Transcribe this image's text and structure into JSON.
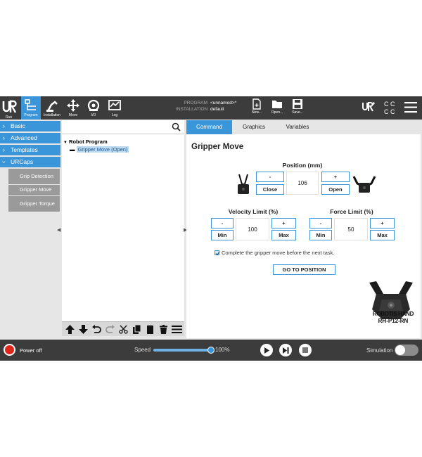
{
  "header": {
    "nav": [
      {
        "label": "Run",
        "icon": "run-icon"
      },
      {
        "label": "Program",
        "icon": "program-icon"
      },
      {
        "label": "Installation",
        "icon": "installation-icon"
      },
      {
        "label": "Move",
        "icon": "move-icon"
      },
      {
        "label": "I/O",
        "icon": "io-icon"
      },
      {
        "label": "Log",
        "icon": "log-icon"
      }
    ],
    "program_label": "PROGRAM",
    "program_value": "<unnamed>*",
    "installation_label": "INSTALLATION",
    "installation_value": "default",
    "file_buttons": [
      {
        "label": "New...",
        "icon": "new-file-icon"
      },
      {
        "label": "Open...",
        "icon": "open-folder-icon"
      },
      {
        "label": "Save...",
        "icon": "save-icon"
      }
    ]
  },
  "sidebar": {
    "categories": [
      "Basic",
      "Advanced",
      "Templates",
      "URCaps"
    ],
    "urcaps_items": [
      "Grip Detection",
      "Gripper Move",
      "Gripper Torque"
    ]
  },
  "tree": {
    "root": "Robot Program",
    "child": "Gripper Move (Open)"
  },
  "tabs": [
    "Command",
    "Graphics",
    "Variables"
  ],
  "panel": {
    "title": "Gripper Move",
    "position": {
      "title": "Position (mm)",
      "minus": "-",
      "plus": "+",
      "value": "106",
      "close": "Close",
      "open": "Open"
    },
    "velocity": {
      "title": "Velocity Limit (%)",
      "minus": "-",
      "plus": "+",
      "value": "100",
      "min": "Min",
      "max": "Max"
    },
    "force": {
      "title": "Force Limit (%)",
      "minus": "-",
      "plus": "+",
      "value": "50",
      "min": "Min",
      "max": "Max"
    },
    "checkbox_label": "Complete the gripper move before the next task.",
    "goto_label": "GO TO POSITION",
    "brand_line1": "ROBOTIS HAND",
    "brand_line2": "RH-P12-RN"
  },
  "footer": {
    "power_label": "Power off",
    "speed_label": "Speed",
    "speed_value": "100%",
    "speed_fraction": 1.0,
    "simulation_label": "Simulation"
  },
  "colors": {
    "accent": "#3a96d8",
    "header_bg": "#3c3c3c",
    "power": "#e0261c"
  }
}
